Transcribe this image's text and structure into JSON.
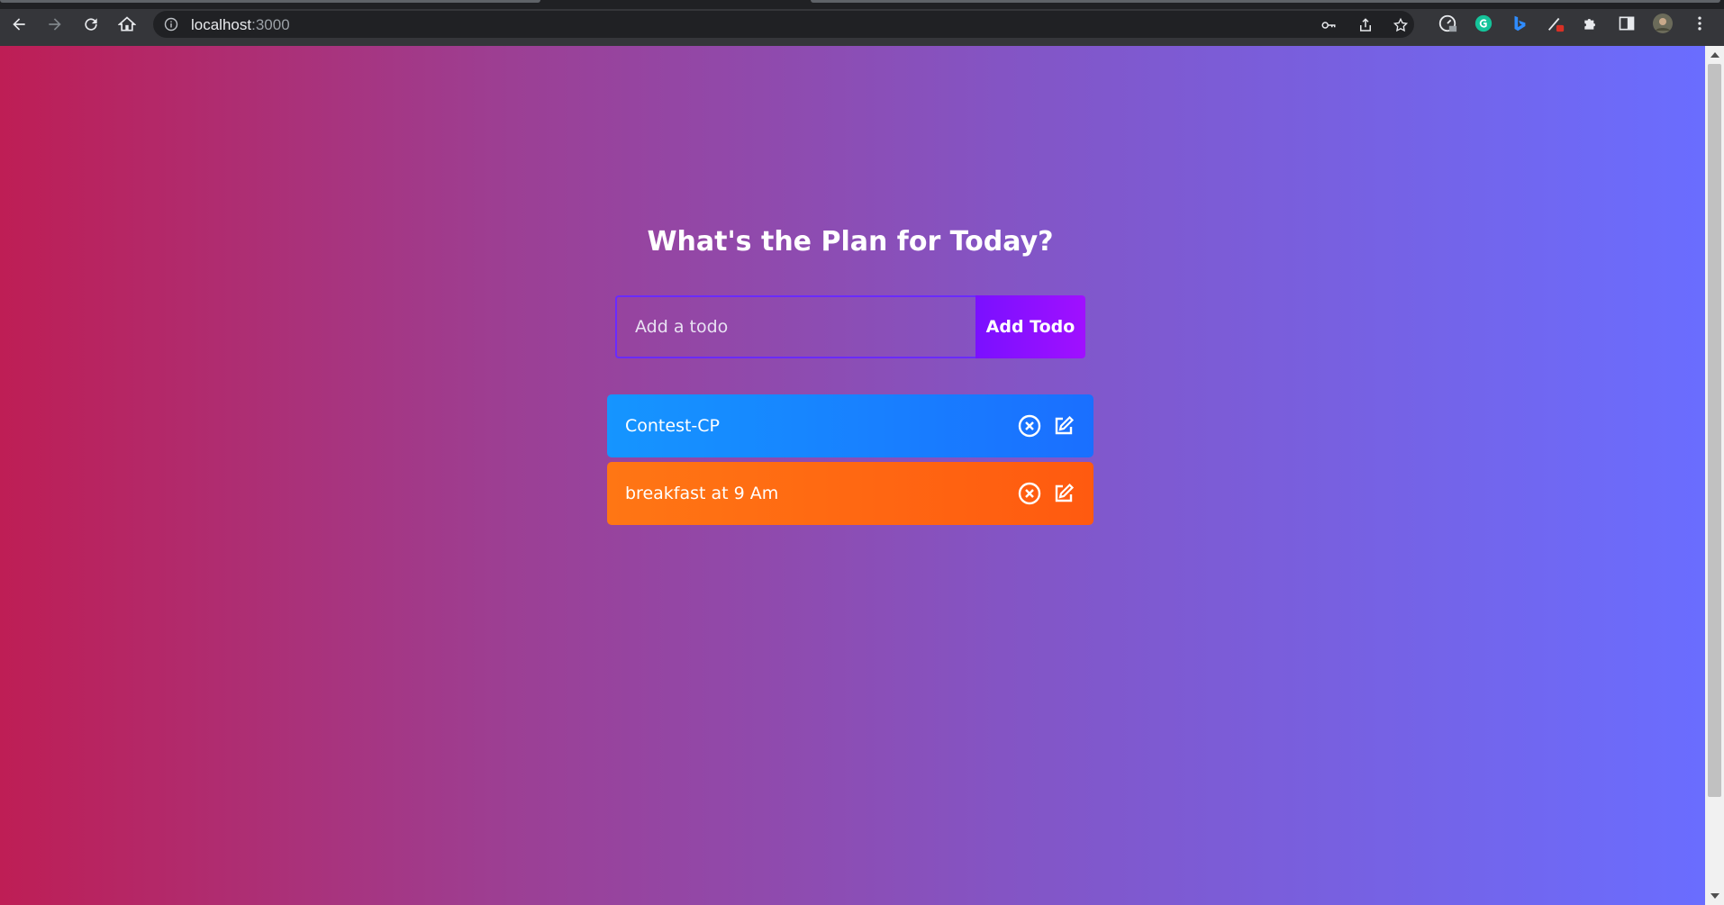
{
  "browser": {
    "url_host": "localhost",
    "url_port": ":3000"
  },
  "app": {
    "title": "What's the Plan for Today?",
    "input_placeholder": "Add a todo",
    "add_button_label": "Add Todo"
  },
  "todos": [
    {
      "text": "Contest-CP",
      "color": "#1595ff"
    },
    {
      "text": "breakfast at 9 Am",
      "color": "#ff7614"
    }
  ],
  "icons": {
    "delete": "circle-x-icon",
    "edit": "pencil-square-icon"
  }
}
